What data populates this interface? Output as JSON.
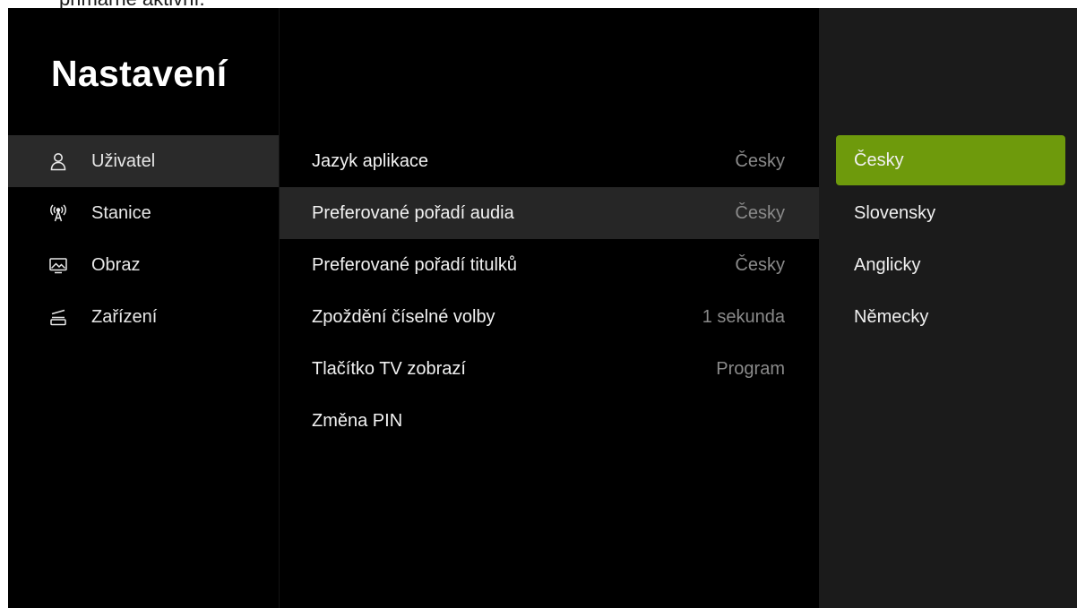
{
  "overlay_fragment": "primárně aktivní.",
  "app": {
    "title": "Nastavení"
  },
  "sidebar": {
    "items": [
      {
        "label": "Uživatel",
        "icon": "user-icon",
        "active": true
      },
      {
        "label": "Stanice",
        "icon": "antenna-icon",
        "active": false
      },
      {
        "label": "Obraz",
        "icon": "screen-image-icon",
        "active": false
      },
      {
        "label": "Zařízení",
        "icon": "device-icon",
        "active": false
      }
    ]
  },
  "settings": {
    "rows": [
      {
        "label": "Jazyk aplikace",
        "value": "Česky"
      },
      {
        "label": "Preferované pořadí audia",
        "value": "Česky"
      },
      {
        "label": "Preferované pořadí titulků",
        "value": "Česky"
      },
      {
        "label": "Zpoždění číselné volby",
        "value": "1 sekunda"
      },
      {
        "label": "Tlačítko TV zobrazí",
        "value": "Program"
      },
      {
        "label": "Změna PIN",
        "value": ""
      }
    ],
    "active_index": 1
  },
  "options": {
    "items": [
      "Česky",
      "Slovensky",
      "Anglicky",
      "Německy"
    ],
    "selected_index": 0
  },
  "colors": {
    "accent": "#6e9a0c",
    "background": "#000000",
    "panel_right": "#1b1b1b",
    "active_row": "#262626",
    "muted_text": "#8a8a8a"
  }
}
